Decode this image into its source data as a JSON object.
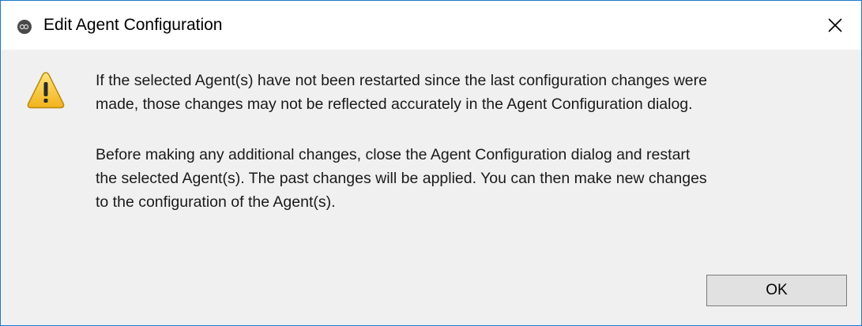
{
  "dialog": {
    "title": "Edit Agent Configuration",
    "app_icon": "app-logo-icon",
    "close_icon": "close-icon",
    "warning_icon": "warning-icon",
    "message_paragraph_1": "If the selected Agent(s) have not been restarted since the last configuration changes were\nmade, those changes may not be reflected accurately in the Agent Configuration dialog.",
    "message_paragraph_2": "Before making any additional changes, close the Agent Configuration dialog and restart\nthe selected Agent(s). The past changes will be applied.  You can then make new changes\nto the configuration of the Agent(s).",
    "ok_label": "OK"
  },
  "colors": {
    "window_border": "#1e78c8",
    "dialog_background": "#f0f0f0",
    "titlebar_background": "#ffffff",
    "warning_yellow": "#f7c62f"
  }
}
